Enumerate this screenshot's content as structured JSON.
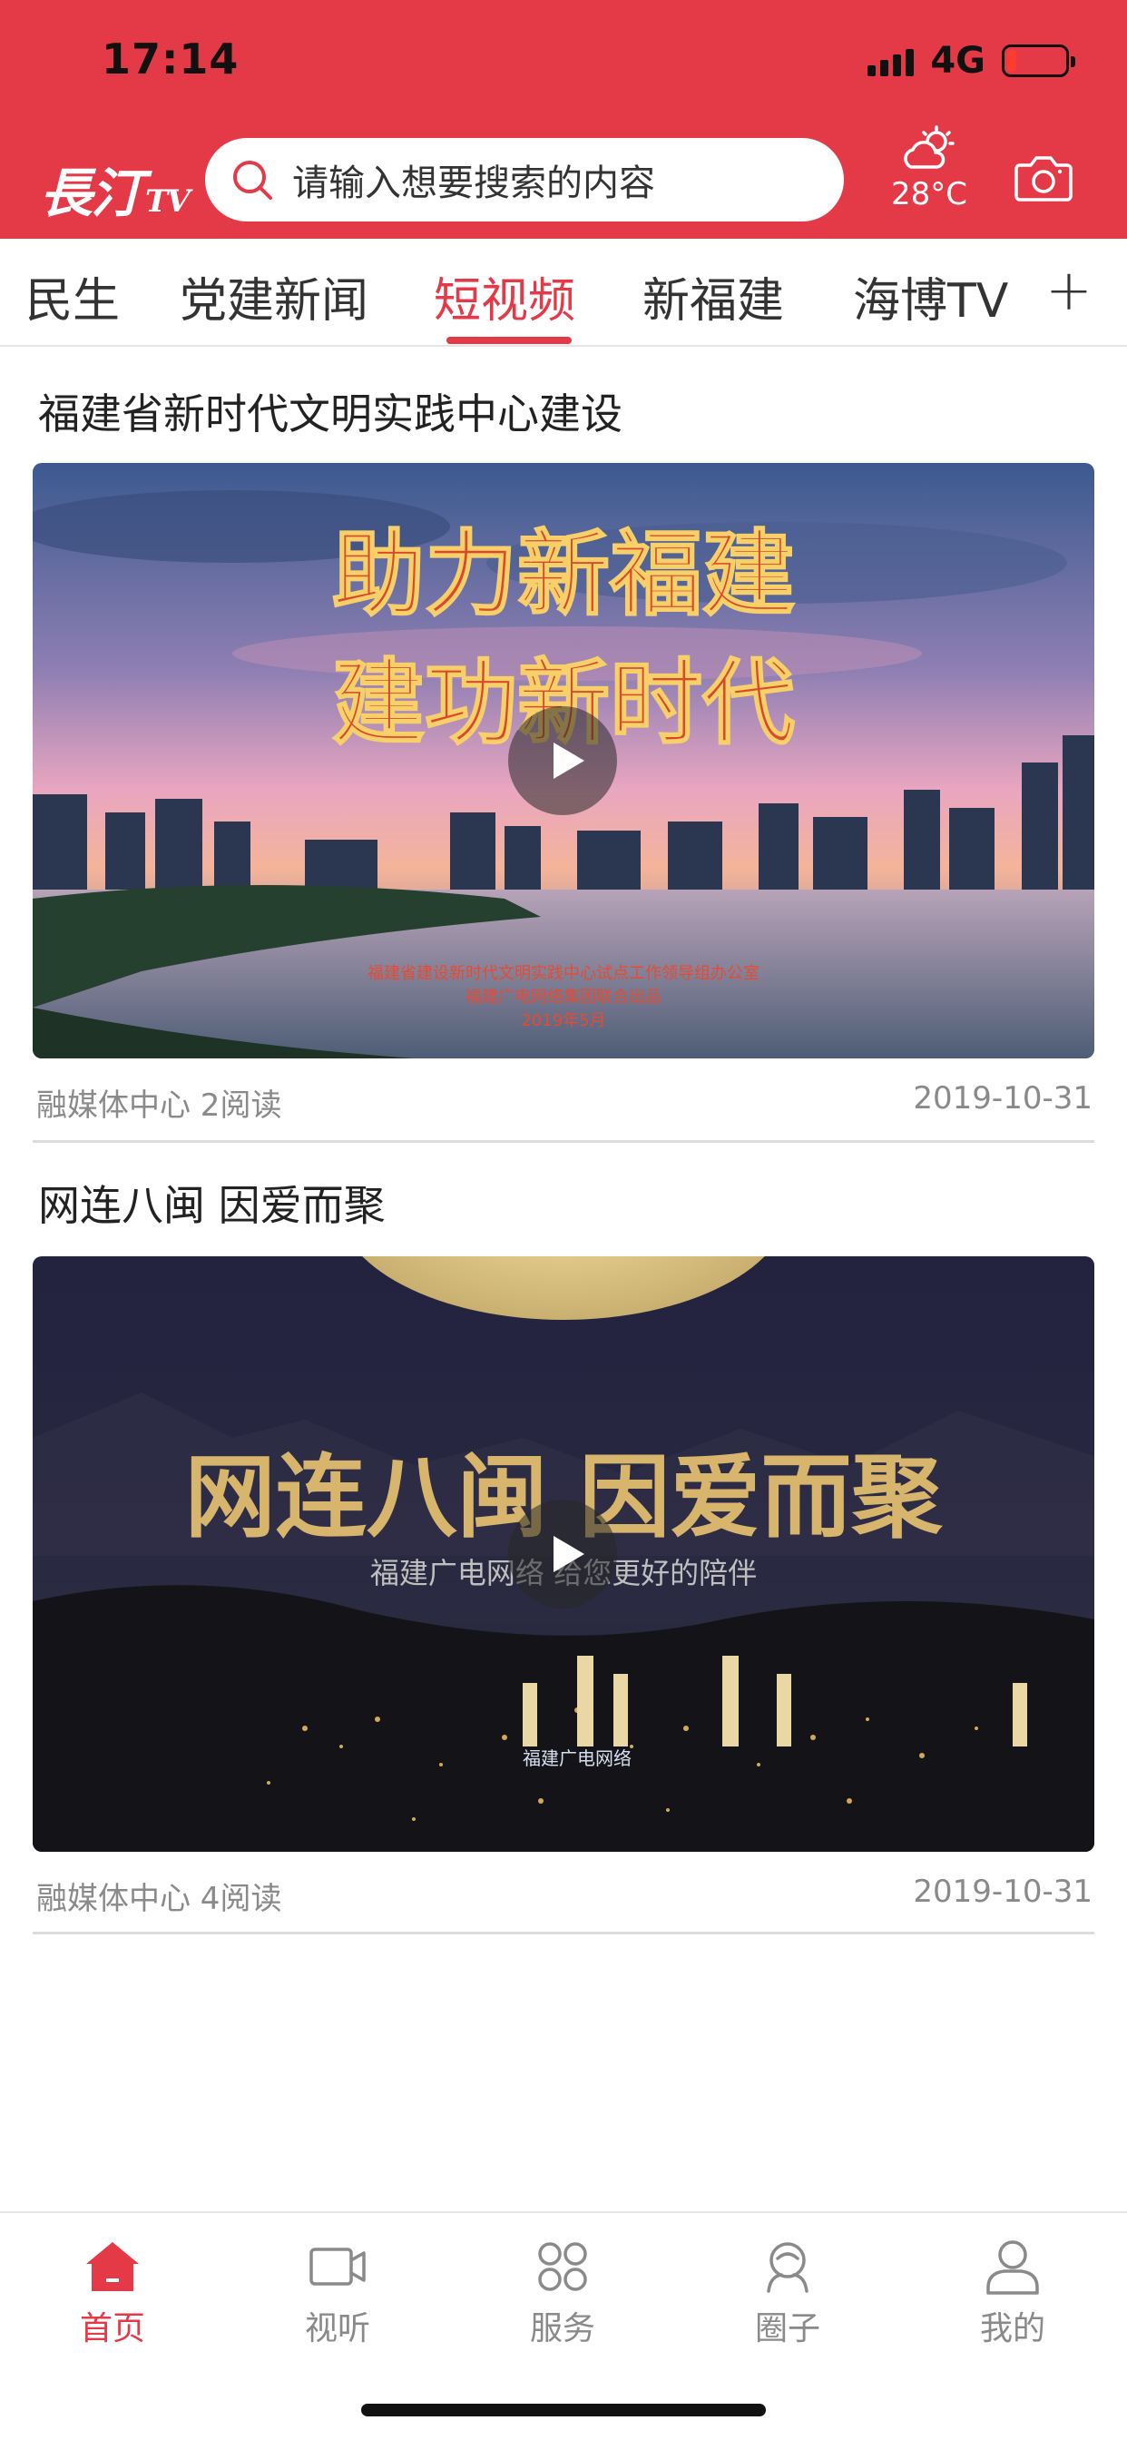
{
  "status_bar": {
    "time": "17:14",
    "network": "4G",
    "battery_level_percent": 15
  },
  "header": {
    "logo_main": "長汀",
    "logo_suffix": "TV",
    "search_placeholder": "请输入想要搜索的内容",
    "weather": {
      "temperature": "28°C",
      "icon": "partly-cloudy-sun-icon"
    },
    "camera_icon": "camera-icon",
    "accent_color": "#e43a48"
  },
  "tabs": {
    "items": [
      {
        "label": "民生"
      },
      {
        "label": "党建新闻"
      },
      {
        "label": "短视频"
      },
      {
        "label": "新福建"
      },
      {
        "label": "海博TV"
      }
    ],
    "active": "短视频",
    "add_symbol": "+"
  },
  "feed": [
    {
      "title": "福建省新时代文明实践中心建设",
      "video_caption_line1": "助力新福建",
      "video_caption_line2": "建功新时代",
      "video_credit_1": "福建省建设新时代文明实践中心试点工作领导组办公室",
      "video_credit_2": "福建广电网络集团联合出品",
      "video_credit_3": "2019年5月",
      "source_reads": "融媒体中心 2阅读",
      "date": "2019-10-31"
    },
    {
      "title": "网连八闽 因爱而聚",
      "video_caption_line1": "网连八闽 因爱而聚",
      "video_caption_line2": "福建广电网络 给您更好的陪伴",
      "video_logo": "福建广电网络",
      "source_reads": "融媒体中心 4阅读",
      "date": "2019-10-31"
    }
  ],
  "bottom_nav": {
    "items": [
      {
        "label": "首页",
        "icon": "home-icon"
      },
      {
        "label": "视听",
        "icon": "video-camera-icon"
      },
      {
        "label": "服务",
        "icon": "grid-services-icon"
      },
      {
        "label": "圈子",
        "icon": "circle-community-icon"
      },
      {
        "label": "我的",
        "icon": "user-icon"
      }
    ],
    "active": "首页"
  }
}
